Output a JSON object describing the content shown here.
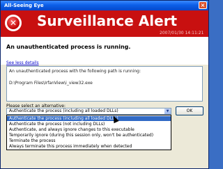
{
  "window": {
    "title": "All-Seeing Eye",
    "close_glyph": "×"
  },
  "banner": {
    "headline": "Surveillance Alert",
    "timestamp": "2007/01/30 14:11:21",
    "icon": "alert-x-icon",
    "color": "#c81010"
  },
  "message": {
    "main": "An unauthenticated process is running."
  },
  "details": {
    "toggle_link": "See less details",
    "line1": "An unauthenticated process with the following path is running:",
    "line2": "D:\\Program Files\\IrfanView\\i_view32.exe"
  },
  "alternative": {
    "label": "Please select an alternative:",
    "selected": "Authenticate the process (including all loaded DLLs)",
    "options": [
      "Authenticate the process (including all loaded DLLs)",
      "Authenticate the process (not including DLLs)",
      "Authenticate, and always ignore changes to this executable",
      "Temporarily ignore (during this session only, won't be authenticated)",
      "Terminate the process",
      "Always terminate this process immediately when detected"
    ]
  },
  "buttons": {
    "ok": "OK"
  }
}
